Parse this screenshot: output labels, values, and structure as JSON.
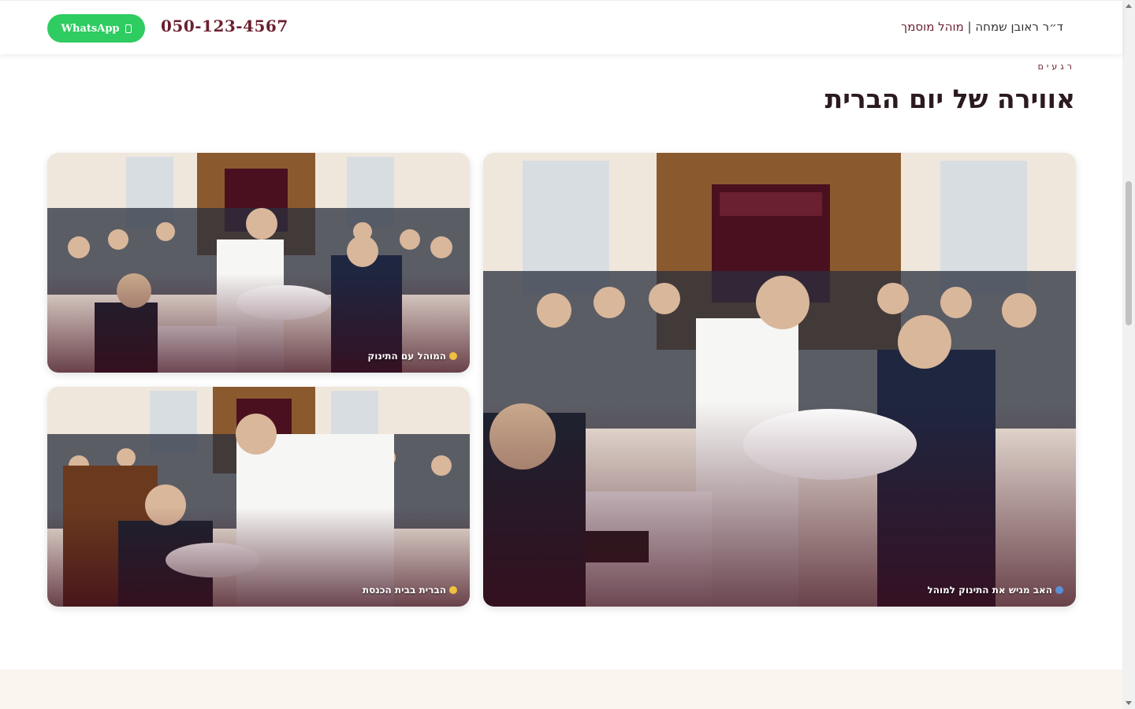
{
  "header": {
    "whatsapp_label": "WhatsApp",
    "phone": "050-123-4567",
    "brand_name": "ד״ר ראובן שמחה | ",
    "brand_sub": "מוהל מוסמך"
  },
  "section": {
    "eyebrow": "רגעים",
    "title": "אווירה של יום הברית"
  },
  "gallery": [
    {
      "caption": "האב מגיש את התינוק למוהל",
      "icon": "person-icon"
    },
    {
      "caption": "המוהל עם התינוק",
      "icon": "smile-icon"
    },
    {
      "caption": "הברית בבית הכנסת",
      "icon": "synagogue-icon"
    }
  ],
  "colors": {
    "accent": "#6b1f2e",
    "whatsapp": "#2ecc61",
    "footer_band": "#faf5ef"
  }
}
